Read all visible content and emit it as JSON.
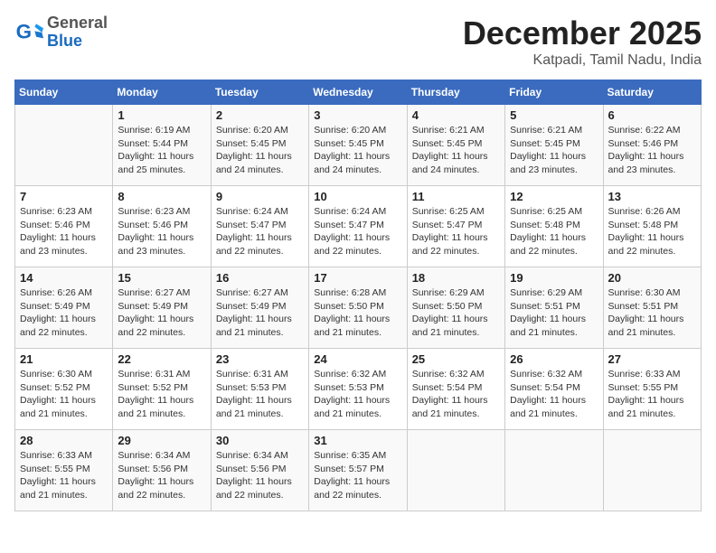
{
  "header": {
    "logo_general": "General",
    "logo_blue": "Blue",
    "month": "December 2025",
    "location": "Katpadi, Tamil Nadu, India"
  },
  "days_of_week": [
    "Sunday",
    "Monday",
    "Tuesday",
    "Wednesday",
    "Thursday",
    "Friday",
    "Saturday"
  ],
  "weeks": [
    [
      {
        "day": "",
        "info": ""
      },
      {
        "day": "1",
        "info": "Sunrise: 6:19 AM\nSunset: 5:44 PM\nDaylight: 11 hours\nand 25 minutes."
      },
      {
        "day": "2",
        "info": "Sunrise: 6:20 AM\nSunset: 5:45 PM\nDaylight: 11 hours\nand 24 minutes."
      },
      {
        "day": "3",
        "info": "Sunrise: 6:20 AM\nSunset: 5:45 PM\nDaylight: 11 hours\nand 24 minutes."
      },
      {
        "day": "4",
        "info": "Sunrise: 6:21 AM\nSunset: 5:45 PM\nDaylight: 11 hours\nand 24 minutes."
      },
      {
        "day": "5",
        "info": "Sunrise: 6:21 AM\nSunset: 5:45 PM\nDaylight: 11 hours\nand 23 minutes."
      },
      {
        "day": "6",
        "info": "Sunrise: 6:22 AM\nSunset: 5:46 PM\nDaylight: 11 hours\nand 23 minutes."
      }
    ],
    [
      {
        "day": "7",
        "info": "Sunrise: 6:23 AM\nSunset: 5:46 PM\nDaylight: 11 hours\nand 23 minutes."
      },
      {
        "day": "8",
        "info": "Sunrise: 6:23 AM\nSunset: 5:46 PM\nDaylight: 11 hours\nand 23 minutes."
      },
      {
        "day": "9",
        "info": "Sunrise: 6:24 AM\nSunset: 5:47 PM\nDaylight: 11 hours\nand 22 minutes."
      },
      {
        "day": "10",
        "info": "Sunrise: 6:24 AM\nSunset: 5:47 PM\nDaylight: 11 hours\nand 22 minutes."
      },
      {
        "day": "11",
        "info": "Sunrise: 6:25 AM\nSunset: 5:47 PM\nDaylight: 11 hours\nand 22 minutes."
      },
      {
        "day": "12",
        "info": "Sunrise: 6:25 AM\nSunset: 5:48 PM\nDaylight: 11 hours\nand 22 minutes."
      },
      {
        "day": "13",
        "info": "Sunrise: 6:26 AM\nSunset: 5:48 PM\nDaylight: 11 hours\nand 22 minutes."
      }
    ],
    [
      {
        "day": "14",
        "info": "Sunrise: 6:26 AM\nSunset: 5:49 PM\nDaylight: 11 hours\nand 22 minutes."
      },
      {
        "day": "15",
        "info": "Sunrise: 6:27 AM\nSunset: 5:49 PM\nDaylight: 11 hours\nand 22 minutes."
      },
      {
        "day": "16",
        "info": "Sunrise: 6:27 AM\nSunset: 5:49 PM\nDaylight: 11 hours\nand 21 minutes."
      },
      {
        "day": "17",
        "info": "Sunrise: 6:28 AM\nSunset: 5:50 PM\nDaylight: 11 hours\nand 21 minutes."
      },
      {
        "day": "18",
        "info": "Sunrise: 6:29 AM\nSunset: 5:50 PM\nDaylight: 11 hours\nand 21 minutes."
      },
      {
        "day": "19",
        "info": "Sunrise: 6:29 AM\nSunset: 5:51 PM\nDaylight: 11 hours\nand 21 minutes."
      },
      {
        "day": "20",
        "info": "Sunrise: 6:30 AM\nSunset: 5:51 PM\nDaylight: 11 hours\nand 21 minutes."
      }
    ],
    [
      {
        "day": "21",
        "info": "Sunrise: 6:30 AM\nSunset: 5:52 PM\nDaylight: 11 hours\nand 21 minutes."
      },
      {
        "day": "22",
        "info": "Sunrise: 6:31 AM\nSunset: 5:52 PM\nDaylight: 11 hours\nand 21 minutes."
      },
      {
        "day": "23",
        "info": "Sunrise: 6:31 AM\nSunset: 5:53 PM\nDaylight: 11 hours\nand 21 minutes."
      },
      {
        "day": "24",
        "info": "Sunrise: 6:32 AM\nSunset: 5:53 PM\nDaylight: 11 hours\nand 21 minutes."
      },
      {
        "day": "25",
        "info": "Sunrise: 6:32 AM\nSunset: 5:54 PM\nDaylight: 11 hours\nand 21 minutes."
      },
      {
        "day": "26",
        "info": "Sunrise: 6:32 AM\nSunset: 5:54 PM\nDaylight: 11 hours\nand 21 minutes."
      },
      {
        "day": "27",
        "info": "Sunrise: 6:33 AM\nSunset: 5:55 PM\nDaylight: 11 hours\nand 21 minutes."
      }
    ],
    [
      {
        "day": "28",
        "info": "Sunrise: 6:33 AM\nSunset: 5:55 PM\nDaylight: 11 hours\nand 21 minutes."
      },
      {
        "day": "29",
        "info": "Sunrise: 6:34 AM\nSunset: 5:56 PM\nDaylight: 11 hours\nand 22 minutes."
      },
      {
        "day": "30",
        "info": "Sunrise: 6:34 AM\nSunset: 5:56 PM\nDaylight: 11 hours\nand 22 minutes."
      },
      {
        "day": "31",
        "info": "Sunrise: 6:35 AM\nSunset: 5:57 PM\nDaylight: 11 hours\nand 22 minutes."
      },
      {
        "day": "",
        "info": ""
      },
      {
        "day": "",
        "info": ""
      },
      {
        "day": "",
        "info": ""
      }
    ]
  ]
}
